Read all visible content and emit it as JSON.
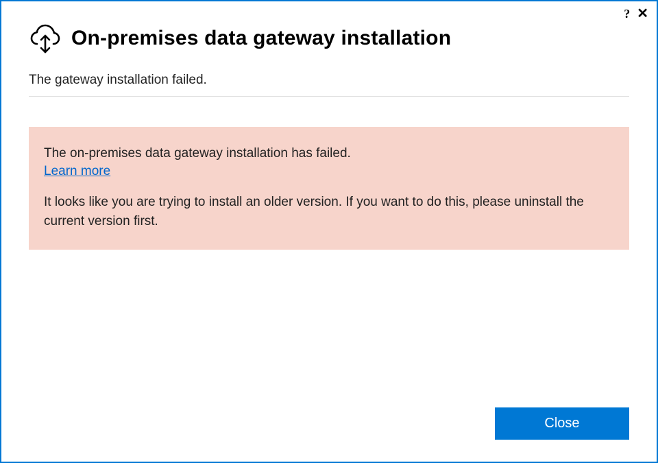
{
  "titlebar": {
    "help_glyph": "?",
    "close_glyph": "✕"
  },
  "header": {
    "title": "On-premises data gateway installation"
  },
  "status": {
    "message": "The gateway installation failed."
  },
  "error": {
    "title": "The on-premises data gateway installation has failed.",
    "learn_more_label": "Learn more",
    "detail": "It looks like you are trying to install an older version. If you want to do this, please uninstall the current version first."
  },
  "footer": {
    "close_label": "Close"
  },
  "colors": {
    "accent": "#0078d4",
    "error_bg": "#f7d4cb",
    "link": "#0066cc"
  }
}
